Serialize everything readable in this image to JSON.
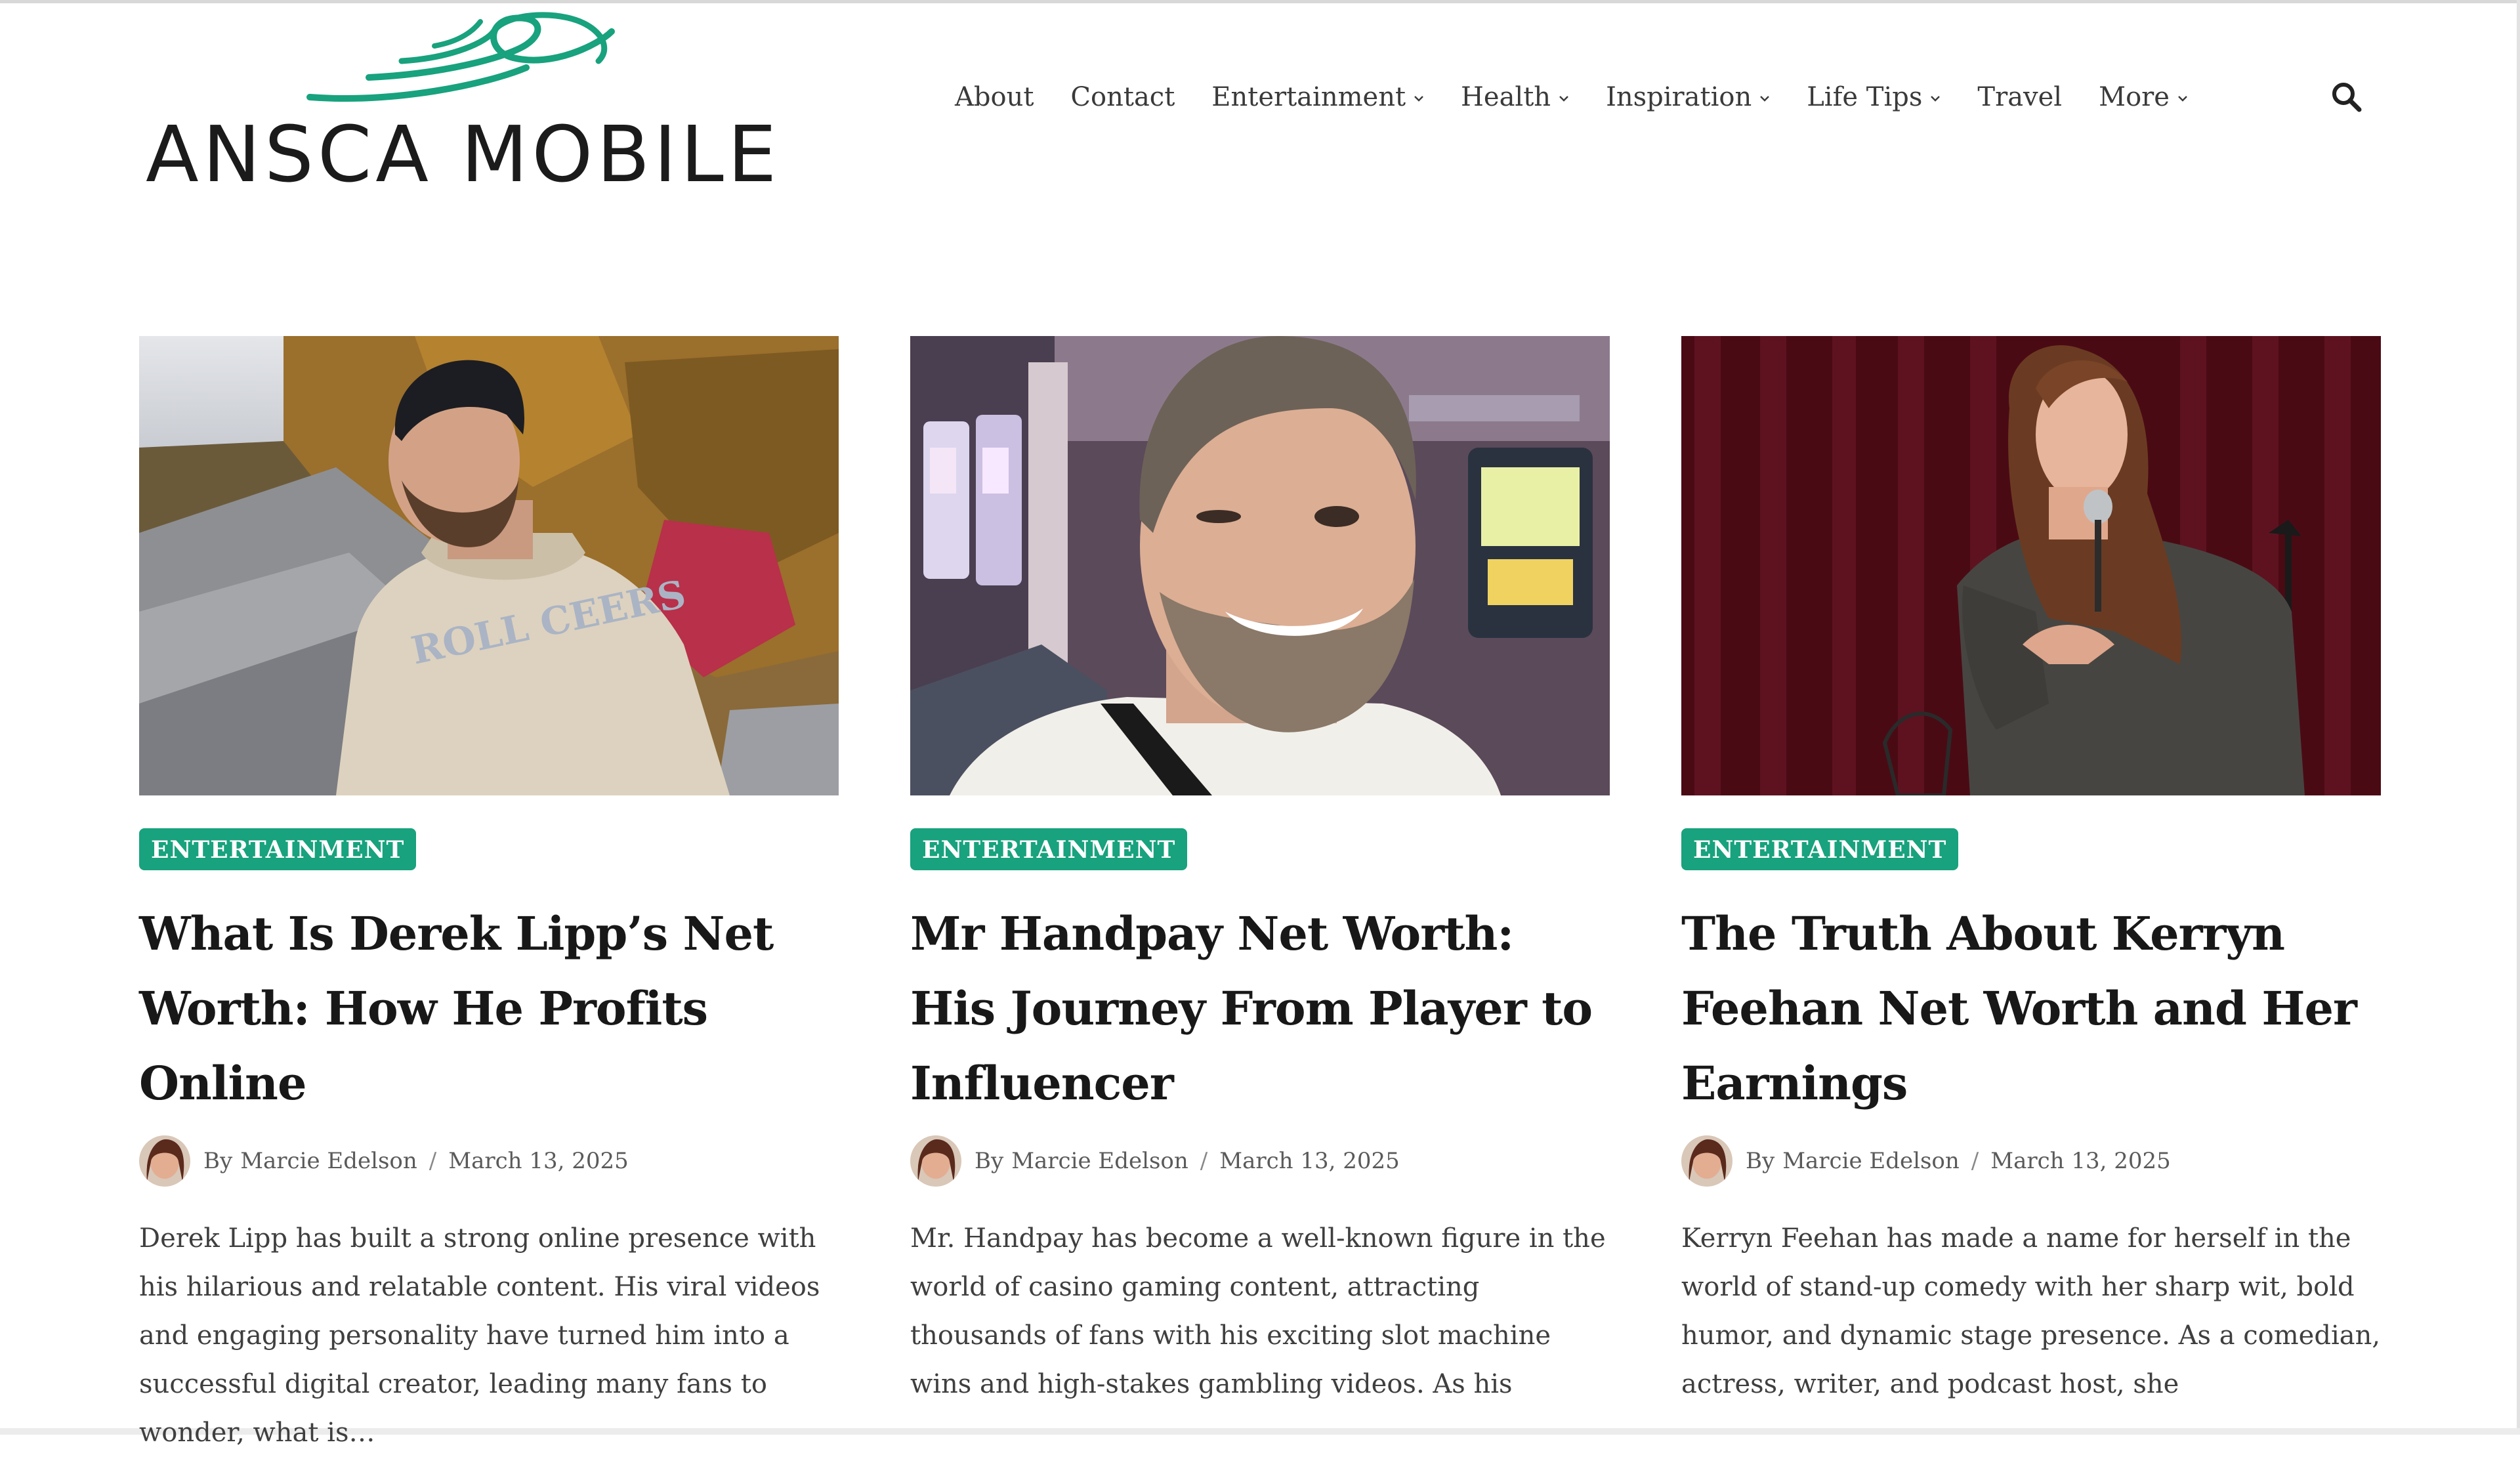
{
  "site": {
    "logo_text": "ANSCA MOBILE",
    "accent_color": "#18a27d"
  },
  "nav": {
    "items": [
      {
        "label": "About",
        "has_dropdown": false
      },
      {
        "label": "Contact",
        "has_dropdown": false
      },
      {
        "label": "Entertainment",
        "has_dropdown": true
      },
      {
        "label": "Health",
        "has_dropdown": true
      },
      {
        "label": "Inspiration",
        "has_dropdown": true
      },
      {
        "label": "Life Tips",
        "has_dropdown": true
      },
      {
        "label": "Travel",
        "has_dropdown": false
      },
      {
        "label": "More",
        "has_dropdown": true
      }
    ],
    "search_icon": "search-icon"
  },
  "posts": [
    {
      "category": "ENTERTAINMENT",
      "title": "What Is Derek Lipp’s Net Worth: How He Profits Online",
      "by": "By",
      "author": "Marcie Edelson",
      "date": "March 13, 2025",
      "excerpt": "Derek Lipp has built a strong online presence with his hilarious and relatable content. His viral videos and engaging personality have turned him into a successful digital creator, leading many fans to wonder, what is…",
      "image_text": "ROLL CEERS"
    },
    {
      "category": "ENTERTAINMENT",
      "title": "Mr Handpay Net Worth: His Journey From Player to Influencer",
      "by": "By",
      "author": "Marcie Edelson",
      "date": "March 13, 2025",
      "excerpt": "Mr. Handpay has become a well-known figure in the world of casino gaming content, attracting thousands of fans with his exciting slot machine wins and high-stakes gambling videos. As his"
    },
    {
      "category": "ENTERTAINMENT",
      "title": "The Truth About Kerryn Feehan Net Worth and Her Earnings",
      "by": "By",
      "author": "Marcie Edelson",
      "date": "March 13, 2025",
      "excerpt": "Kerryn Feehan has made a name for herself in the world of stand-up comedy with her sharp wit, bold humor, and dynamic stage presence. As a comedian, actress, writer, and podcast host, she"
    }
  ]
}
